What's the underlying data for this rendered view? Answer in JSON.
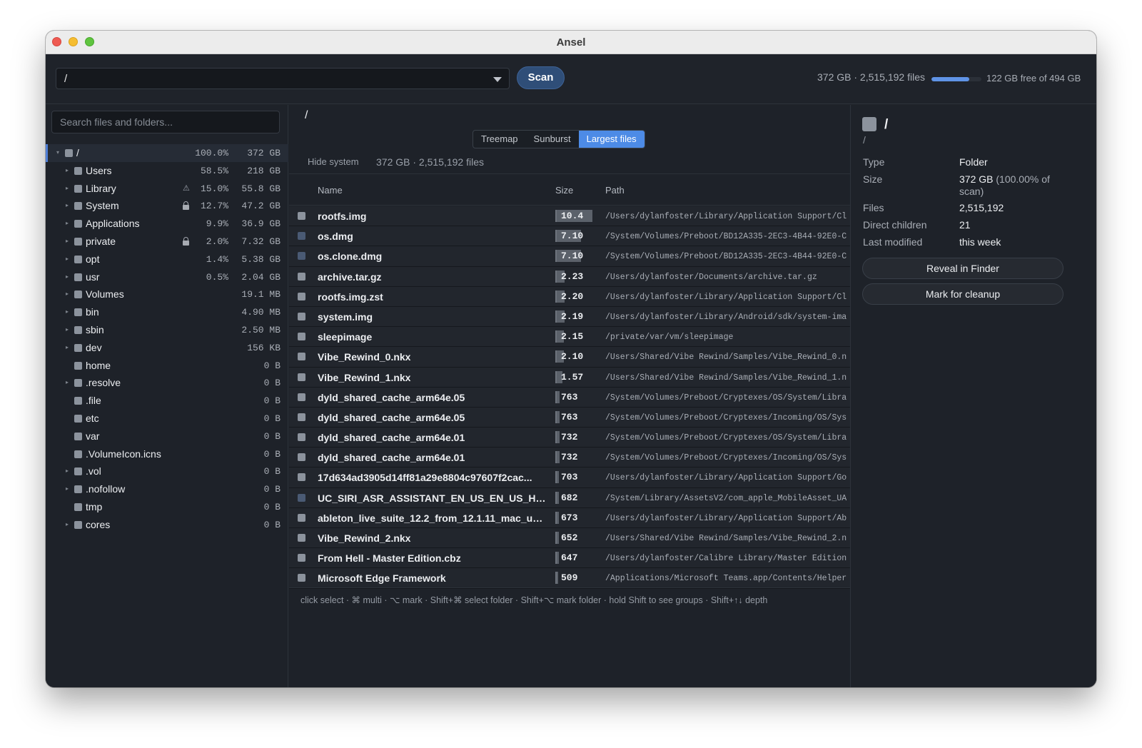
{
  "window": {
    "title": "Ansel"
  },
  "toolbar": {
    "path_value": "/",
    "scan_label": "Scan",
    "scan_summary": "372 GB · 2,515,192 files",
    "disk_used_fraction": 0.753,
    "disk_free_text": "122 GB free of 494 GB"
  },
  "sidebar": {
    "search_placeholder": "Search files and folders...",
    "tree": [
      {
        "name": "/",
        "pct": "100.0%",
        "size": "372 GB",
        "expand": "open",
        "indent": 0,
        "badge": "",
        "selected": true
      },
      {
        "name": "Users",
        "pct": "58.5%",
        "size": "218 GB",
        "expand": "closed",
        "indent": 1,
        "badge": ""
      },
      {
        "name": "Library",
        "pct": "15.0%",
        "size": "55.8 GB",
        "expand": "closed",
        "indent": 1,
        "badge": "warning"
      },
      {
        "name": "System",
        "pct": "12.7%",
        "size": "47.2 GB",
        "expand": "closed",
        "indent": 1,
        "badge": "lock"
      },
      {
        "name": "Applications",
        "pct": "9.9%",
        "size": "36.9 GB",
        "expand": "closed",
        "indent": 1,
        "badge": ""
      },
      {
        "name": "private",
        "pct": "2.0%",
        "size": "7.32 GB",
        "expand": "closed",
        "indent": 1,
        "badge": "lock"
      },
      {
        "name": "opt",
        "pct": "1.4%",
        "size": "5.38 GB",
        "expand": "closed",
        "indent": 1,
        "badge": ""
      },
      {
        "name": "usr",
        "pct": "0.5%",
        "size": "2.04 GB",
        "expand": "closed",
        "indent": 1,
        "badge": ""
      },
      {
        "name": "Volumes",
        "pct": "",
        "size": "19.1 MB",
        "expand": "closed",
        "indent": 1,
        "badge": ""
      },
      {
        "name": "bin",
        "pct": "",
        "size": "4.90 MB",
        "expand": "closed",
        "indent": 1,
        "badge": ""
      },
      {
        "name": "sbin",
        "pct": "",
        "size": "2.50 MB",
        "expand": "closed",
        "indent": 1,
        "badge": ""
      },
      {
        "name": "dev",
        "pct": "",
        "size": "156 KB",
        "expand": "closed",
        "indent": 1,
        "badge": ""
      },
      {
        "name": "home",
        "pct": "",
        "size": "0 B",
        "expand": "none",
        "indent": 1,
        "badge": ""
      },
      {
        "name": ".resolve",
        "pct": "",
        "size": "0 B",
        "expand": "closed",
        "indent": 1,
        "badge": ""
      },
      {
        "name": ".file",
        "pct": "",
        "size": "0 B",
        "expand": "none",
        "indent": 1,
        "badge": ""
      },
      {
        "name": "etc",
        "pct": "",
        "size": "0 B",
        "expand": "none",
        "indent": 1,
        "badge": ""
      },
      {
        "name": "var",
        "pct": "",
        "size": "0 B",
        "expand": "none",
        "indent": 1,
        "badge": ""
      },
      {
        "name": ".VolumeIcon.icns",
        "pct": "",
        "size": "0 B",
        "expand": "none",
        "indent": 1,
        "badge": ""
      },
      {
        "name": ".vol",
        "pct": "",
        "size": "0 B",
        "expand": "closed",
        "indent": 1,
        "badge": ""
      },
      {
        "name": ".nofollow",
        "pct": "",
        "size": "0 B",
        "expand": "closed",
        "indent": 1,
        "badge": ""
      },
      {
        "name": "tmp",
        "pct": "",
        "size": "0 B",
        "expand": "none",
        "indent": 1,
        "badge": ""
      },
      {
        "name": "cores",
        "pct": "",
        "size": "0 B",
        "expand": "closed",
        "indent": 1,
        "badge": ""
      }
    ]
  },
  "main": {
    "path": "/",
    "tabs": [
      {
        "label": "Treemap",
        "active": false
      },
      {
        "label": "Sunburst",
        "active": false
      },
      {
        "label": "Largest files",
        "active": true
      }
    ],
    "hide_system_label": "Hide system",
    "summary": "372 GB · 2,515,192 files",
    "columns": {
      "name": "Name",
      "size": "Size",
      "path": "Path"
    },
    "files": [
      {
        "name": "rootfs.img",
        "size": "10.4",
        "fill": 1.0,
        "color": "gray",
        "path": "/Users/dylanfoster/Library/Application Support/Cl"
      },
      {
        "name": "os.dmg",
        "size": "7.10",
        "fill": 0.683,
        "color": "blue",
        "path": "/System/Volumes/Preboot/BD12A335-2EC3-4B44-92E0-C"
      },
      {
        "name": "os.clone.dmg",
        "size": "7.10",
        "fill": 0.683,
        "color": "blue",
        "path": "/System/Volumes/Preboot/BD12A335-2EC3-4B44-92E0-C"
      },
      {
        "name": "archive.tar.gz",
        "size": "2.23",
        "fill": 0.214,
        "color": "gray",
        "path": "/Users/dylanfoster/Documents/archive.tar.gz"
      },
      {
        "name": "rootfs.img.zst",
        "size": "2.20",
        "fill": 0.212,
        "color": "gray",
        "path": "/Users/dylanfoster/Library/Application Support/Cl"
      },
      {
        "name": "system.img",
        "size": "2.19",
        "fill": 0.211,
        "color": "gray",
        "path": "/Users/dylanfoster/Library/Android/sdk/system-ima"
      },
      {
        "name": "sleepimage",
        "size": "2.15",
        "fill": 0.207,
        "color": "gray",
        "path": "/private/var/vm/sleepimage"
      },
      {
        "name": "Vibe_Rewind_0.nkx",
        "size": "2.10",
        "fill": 0.202,
        "color": "gray",
        "path": "/Users/Shared/Vibe Rewind/Samples/Vibe_Rewind_0.n"
      },
      {
        "name": "Vibe_Rewind_1.nkx",
        "size": "1.57",
        "fill": 0.151,
        "color": "gray",
        "path": "/Users/Shared/Vibe Rewind/Samples/Vibe_Rewind_1.n"
      },
      {
        "name": "dyld_shared_cache_arm64e.05",
        "size": "763",
        "fill": 0.073,
        "color": "gray",
        "path": "/System/Volumes/Preboot/Cryptexes/OS/System/Libra"
      },
      {
        "name": "dyld_shared_cache_arm64e.05",
        "size": "763",
        "fill": 0.073,
        "color": "gray",
        "path": "/System/Volumes/Preboot/Cryptexes/Incoming/OS/Sys"
      },
      {
        "name": "dyld_shared_cache_arm64e.01",
        "size": "732",
        "fill": 0.07,
        "color": "gray",
        "path": "/System/Volumes/Preboot/Cryptexes/OS/System/Libra"
      },
      {
        "name": "dyld_shared_cache_arm64e.01",
        "size": "732",
        "fill": 0.07,
        "color": "gray",
        "path": "/System/Volumes/Preboot/Cryptexes/Incoming/OS/Sys"
      },
      {
        "name": "17d634ad3905d14ff81a29e8804c97607f2cac...",
        "size": "703",
        "fill": 0.068,
        "color": "gray",
        "path": "/Users/dylanfoster/Library/Application Support/Go"
      },
      {
        "name": "UC_SIRI_ASR_ASSISTANT_EN_US_EN_US_H1...",
        "size": "682",
        "fill": 0.066,
        "color": "blue",
        "path": "/System/Library/AssetsV2/com_apple_MobileAsset_UA"
      },
      {
        "name": "ableton_live_suite_12.2_from_12.1.11_mac_uni...",
        "size": "673",
        "fill": 0.065,
        "color": "gray",
        "path": "/Users/dylanfoster/Library/Application Support/Ab"
      },
      {
        "name": "Vibe_Rewind_2.nkx",
        "size": "652",
        "fill": 0.063,
        "color": "gray",
        "path": "/Users/Shared/Vibe Rewind/Samples/Vibe_Rewind_2.n"
      },
      {
        "name": "From Hell - Master Edition.cbz",
        "size": "647",
        "fill": 0.062,
        "color": "gray",
        "path": "/Users/dylanfoster/Calibre Library/Master Edition"
      },
      {
        "name": "Microsoft Edge Framework",
        "size": "509",
        "fill": 0.049,
        "color": "gray",
        "path": "/Applications/Microsoft Teams.app/Contents/Helper"
      }
    ],
    "shortcut_hint": "click select · ⌘ multi · ⌥ mark · Shift+⌘ select folder · Shift+⌥ mark folder · hold Shift to see groups · Shift+↑↓ depth"
  },
  "details": {
    "title": "/",
    "subtitle": "/",
    "type_label": "Type",
    "type_value": "Folder",
    "size_label": "Size",
    "size_value": "372 GB",
    "size_pct": "(100.00% of scan)",
    "files_label": "Files",
    "files_value": "2,515,192",
    "children_label": "Direct children",
    "children_value": "21",
    "modified_label": "Last modified",
    "modified_value": "this week",
    "reveal_label": "Reveal in Finder",
    "cleanup_label": "Mark for cleanup"
  },
  "colors": {
    "accent": "#4d8be6",
    "square_gray": "#8c939d",
    "square_blue": "#4a5a74",
    "background": "#1e2229"
  }
}
